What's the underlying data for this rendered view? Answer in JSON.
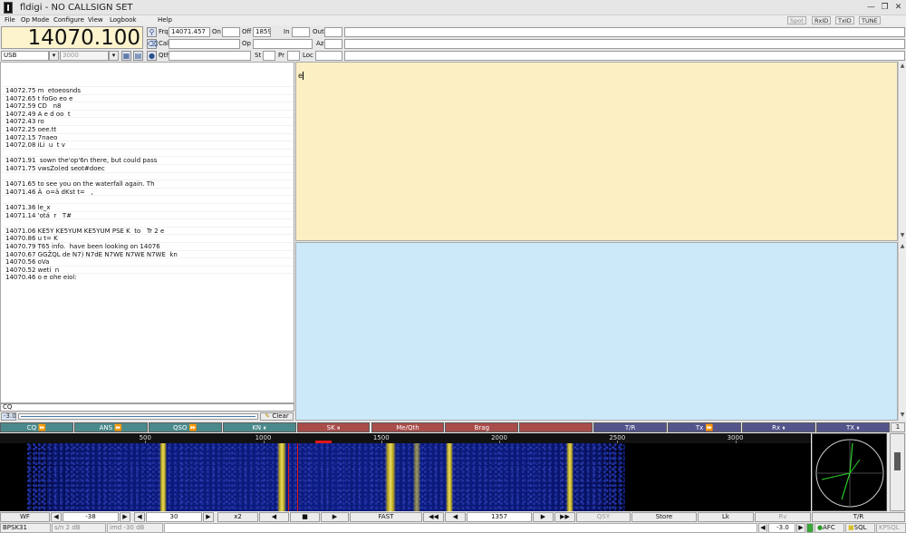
{
  "window": {
    "title": "fldigi - NO CALLSIGN SET",
    "min_icon": "minimize-icon",
    "max_icon": "maximize-icon",
    "close_icon": "close-icon"
  },
  "menu": {
    "items": [
      "File",
      "Op Mode",
      "Configure",
      "View",
      "Logbook",
      "Help"
    ],
    "toggles": [
      "Spot",
      "RxID",
      "TxID",
      "TUNE"
    ]
  },
  "freq_panel": {
    "frequency": "14070.100",
    "mode": "USB",
    "bandwidth": "3000",
    "frq_label": "Frq",
    "frq_value": "14071.457",
    "on_label": "On",
    "off_label": "Off",
    "off_value": "1859",
    "in_label": "In",
    "out_label": "Out",
    "call_label": "Call",
    "op_label": "Op",
    "az_label": "Az",
    "qth_label": "Qth",
    "st_label": "St",
    "pr_label": "Pr",
    "loc_label": "Loc"
  },
  "rx_text": [
    {
      "f": "14072.75",
      "t": "m  etoeosnds"
    },
    {
      "f": "14072.65",
      "t": "t foGo eo e"
    },
    {
      "f": "14072.59",
      "t": "CD   n8"
    },
    {
      "f": "14072.49",
      "t": "A e d oo  t"
    },
    {
      "f": "14072.43",
      "t": "ro"
    },
    {
      "f": "14072.25",
      "t": "oee.tt"
    },
    {
      "f": "14072.15",
      "t": "7naeo"
    },
    {
      "f": "14072.08",
      "t": "iLi  u  t v"
    },
    {
      "f": "",
      "t": ""
    },
    {
      "f": "14071.91",
      "t": " sown the'op'6n there, but could pass"
    },
    {
      "f": "14071.75",
      "t": "vwsZo(ed seot#doec"
    },
    {
      "f": "",
      "t": ""
    },
    {
      "f": "14071.65",
      "t": "to see you on the waterfall again. Th"
    },
    {
      "f": "14071.46",
      "t": "À  o=ä dKst t=   ,"
    },
    {
      "f": "",
      "t": ""
    },
    {
      "f": "14071.36",
      "t": "le_x"
    },
    {
      "f": "14071.14",
      "t": "'otá  r   T#"
    },
    {
      "f": "",
      "t": ""
    },
    {
      "f": "14071.06",
      "t": "KE5Y KE5YUM KE5YUM PSE K  to   Tr 2 e"
    },
    {
      "f": "14070.86",
      "t": "u t= K"
    },
    {
      "f": "14070.79",
      "t": "T65 info.  have been looking on 14076"
    },
    {
      "f": "14070.67",
      "t": "GGŽQL de N7) N7dE N7WE N7WE N7WE  kn"
    },
    {
      "f": "14070.56",
      "t": "oVa"
    },
    {
      "f": "14070.52",
      "t": "weti  n"
    },
    {
      "f": "14070.46",
      "t": "o e ohe eiol:"
    }
  ],
  "tx_text": "e",
  "cq_input": "CQ",
  "rx_level": "-3.0",
  "clear_label": "Clear",
  "macros": [
    {
      "label": "CQ ⏩",
      "color": "teal"
    },
    {
      "label": "ANS ⏩",
      "color": "teal"
    },
    {
      "label": "QSO ⏩",
      "color": "teal"
    },
    {
      "label": "KN ⏸",
      "color": "teal"
    },
    {
      "label": "SK ⏸",
      "color": "red"
    },
    {
      "label": "Me/Qth",
      "color": "red"
    },
    {
      "label": "Brag",
      "color": "red"
    },
    {
      "label": "",
      "color": "red"
    },
    {
      "label": "T/R",
      "color": "blue"
    },
    {
      "label": "Tx ⏩",
      "color": "blue"
    },
    {
      "label": "Rx ⏸",
      "color": "blue"
    },
    {
      "label": "TX ⏸",
      "color": "blue"
    }
  ],
  "macro_page": "1",
  "waterfall": {
    "scale_ticks": [
      500,
      1000,
      1500,
      2000,
      2500,
      3000
    ],
    "cursor_hz": 1250,
    "signals_hz": [
      575,
      1080,
      1540,
      1650,
      1790,
      2300
    ]
  },
  "wf_controls": {
    "wf": "WF",
    "level": "-38",
    "range": "30",
    "zoom": "x2",
    "speed": "FAST",
    "carrier": "1357",
    "qsy": "QSY",
    "store": "Store",
    "lk": "Lk",
    "rv": "Rv",
    "tr": "T/R"
  },
  "status": {
    "mode": "BPSK31",
    "sn": "s/n  2 dB",
    "imd": "imd -30 dB",
    "tx_level": "-3.0",
    "afc": "AFC",
    "sql": "SQL",
    "kpsql": "KPSQL"
  },
  "colors": {
    "tx_top_bg": "#fdefc4",
    "tx_bot_bg": "#cce9f9",
    "freq_bg": "#fdf3cd",
    "macro_teal": "#4b8a8c",
    "macro_red": "#a84d4a",
    "macro_blue": "#54548c"
  }
}
